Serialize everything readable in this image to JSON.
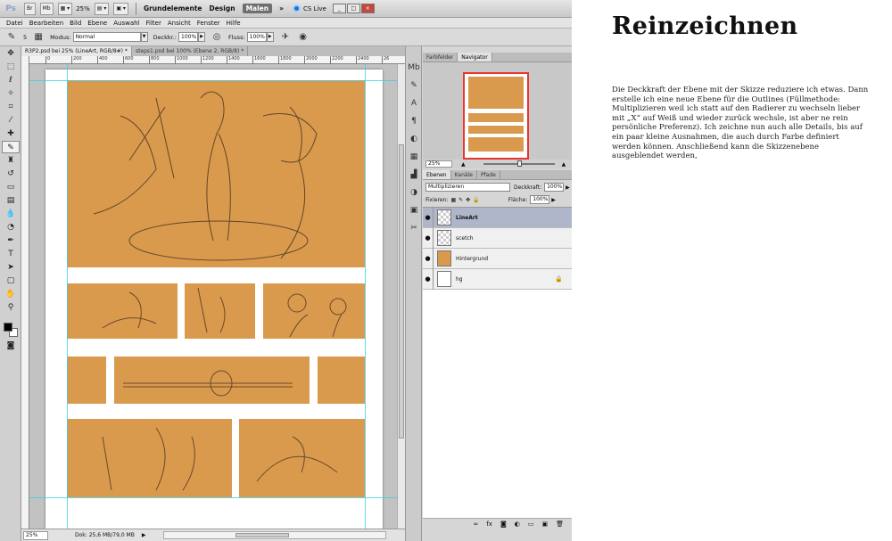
{
  "app": {
    "logo": "Ps",
    "zoom_box": "25%",
    "workspaces": [
      "Grundelemente",
      "Design",
      "Malen"
    ],
    "active_workspace": "Malen",
    "more": "»",
    "cs_live": "CS Live",
    "win_min": "_",
    "win_max": "□",
    "win_close": "×"
  },
  "menu": [
    "Datei",
    "Bearbeiten",
    "Bild",
    "Ebene",
    "Auswahl",
    "Filter",
    "Ansicht",
    "Fenster",
    "Hilfe"
  ],
  "options": {
    "brush_size": "5",
    "modus_label": "Modus:",
    "modus_value": "Normal",
    "deckkr_label": "Deckkr.:",
    "deckkr_value": "100%",
    "fluss_label": "Fluss:",
    "fluss_value": "100%"
  },
  "doc_tabs": [
    "R3P2.psd bei 25% (LineArt, RGB/8#) *",
    "steps1.psd bei 100% (Ebene 2, RGB/8) *"
  ],
  "ruler_ticks": [
    "0",
    "200",
    "400",
    "600",
    "800",
    "1000",
    "1200",
    "1400",
    "1600",
    "1800",
    "2000",
    "2200",
    "2400",
    "26"
  ],
  "status": {
    "zoom": "25%",
    "doc": "Dok: 25,6 MB/79,0 MB"
  },
  "navigator": {
    "tabs": [
      "Farbfelder",
      "Navigator"
    ],
    "active_tab": "Navigator",
    "zoom": "25%"
  },
  "layers_panel": {
    "tabs": [
      "Ebenen",
      "Kanäle",
      "Pfade"
    ],
    "blend_mode": "Multiplizieren",
    "opacity_label": "Deckkraft:",
    "opacity_value": "100%",
    "lock_label": "Fixieren:",
    "fill_label": "Fläche:",
    "fill_value": "100%",
    "layers": [
      {
        "name": "LineArt",
        "thumb": "checker",
        "active": true,
        "locked": false
      },
      {
        "name": "scetch",
        "thumb": "checker",
        "active": false,
        "locked": false
      },
      {
        "name": "Hintergrund",
        "thumb": "#d99a4e",
        "active": false,
        "locked": false
      },
      {
        "name": "hg",
        "thumb": "#ffffff",
        "active": false,
        "locked": true
      }
    ]
  },
  "colors": {
    "panel_orange": "#d99a4e",
    "guide_cyan": "#38d0e8",
    "nav_frame": "#e8352f",
    "active_layer": "#b0b6c9"
  },
  "article": {
    "title": "Reinzeichnen",
    "body": "Die Deckkraft der Ebene mit der Skizze reduziere ich etwas. Dann erstelle ich eine neue Ebene für die Outlines (Füllmethode: Multiplizieren weil ich statt auf den Radierer zu wechseln lieber mit „X“ auf Weiß und wieder zurück wechsle, ist aber ne rein persönliche Preferenz). Ich zeichne nun auch alle Details, bis auf ein paar kleine Ausnahmen, die auch durch Farbe definiert werden können. Anschließend kann die Skizzenebene ausgeblendet werden,"
  }
}
